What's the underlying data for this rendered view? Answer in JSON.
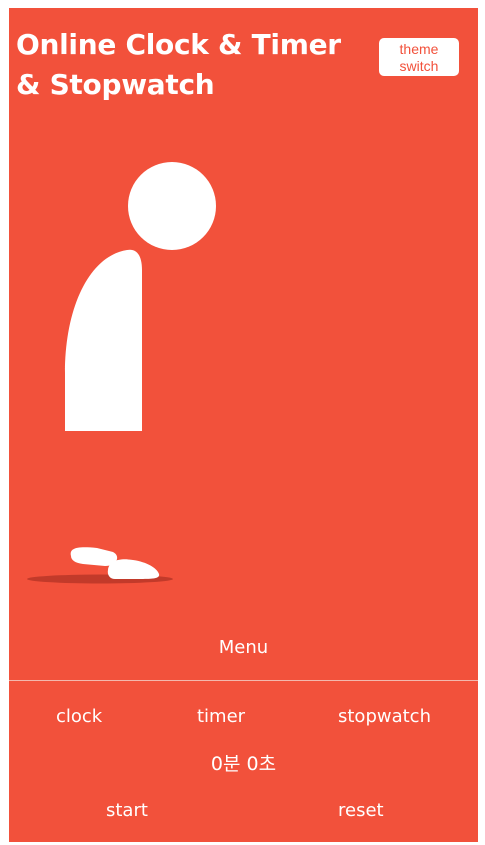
{
  "header": {
    "title": "Online Clock & Timer & Stopwatch",
    "theme_switch_label": "theme switch"
  },
  "menu": {
    "label": "Menu",
    "tabs": [
      {
        "label": "clock"
      },
      {
        "label": "timer"
      },
      {
        "label": "stopwatch"
      }
    ]
  },
  "display": {
    "time": "0분 0초"
  },
  "controls": {
    "start_label": "start",
    "reset_label": "reset"
  },
  "theme": {
    "background": "#f2513b",
    "foreground": "#ffffff"
  }
}
